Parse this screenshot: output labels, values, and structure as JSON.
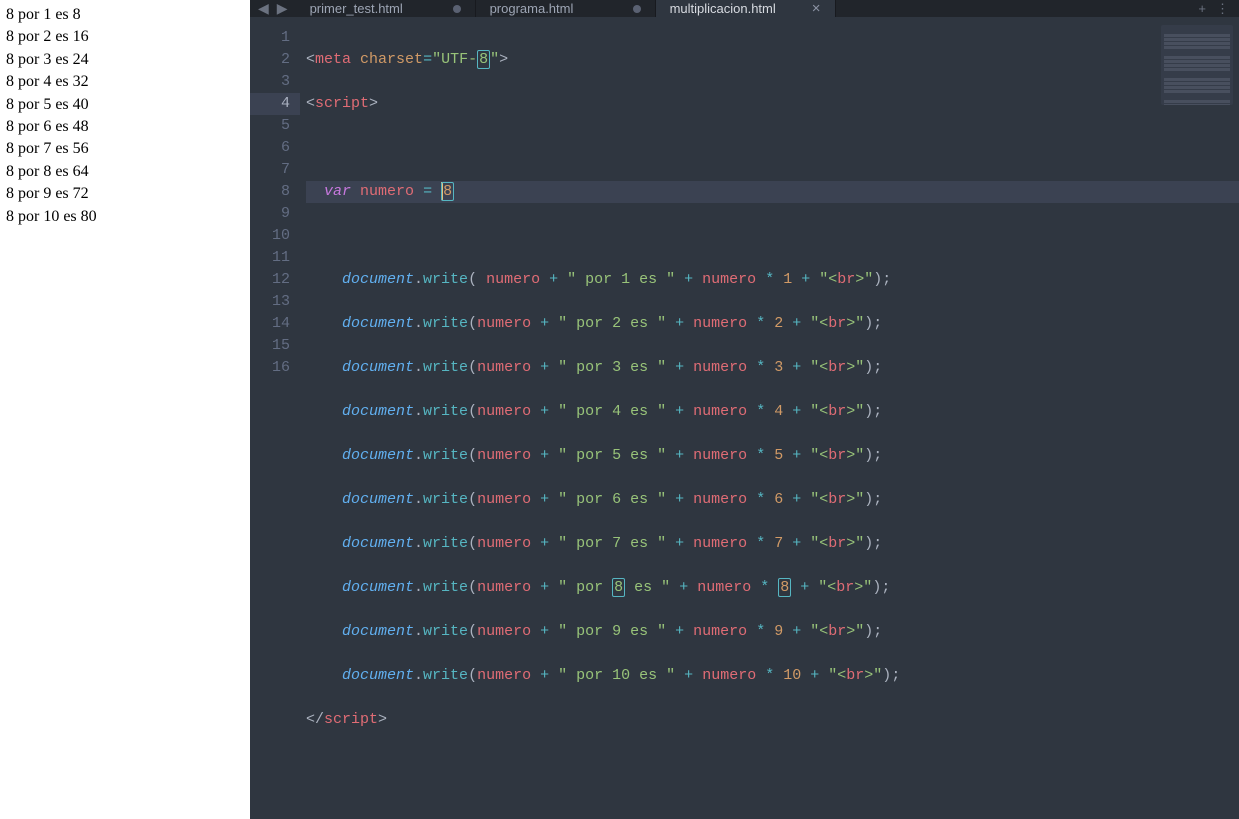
{
  "browser_output": [
    "8 por 1 es 8",
    "8 por 2 es 16",
    "8 por 3 es 24",
    "8 por 4 es 32",
    "8 por 5 es 40",
    "8 por 6 es 48",
    "8 por 7 es 56",
    "8 por 8 es 64",
    "8 por 9 es 72",
    "8 por 10 es 80"
  ],
  "tabs": [
    {
      "label": "primer_test.html",
      "active": false,
      "dirty": true
    },
    {
      "label": "programa.html",
      "active": false,
      "dirty": true
    },
    {
      "label": "multiplicacion.html",
      "active": true,
      "dirty": false
    }
  ],
  "nav": {
    "back": "◀",
    "forward": "▶",
    "plus": "+",
    "more": "⋮"
  },
  "line_numbers": [
    "1",
    "2",
    "3",
    "4",
    "5",
    "6",
    "7",
    "8",
    "9",
    "10",
    "11",
    "12",
    "13",
    "14",
    "15",
    "16"
  ],
  "active_line": 4,
  "code": {
    "l1": {
      "open": "<",
      "tag": "meta",
      "attr": "charset",
      "eq": "=",
      "q1": "\"",
      "str_a": "UTF-",
      "str_hl": "8",
      "q2": "\"",
      "close": ">"
    },
    "l2": {
      "open": "<",
      "tag": "script",
      "close": ">"
    },
    "l4": {
      "key": "var",
      "name": "numero",
      "eq": " = ",
      "val": "8"
    },
    "dw": {
      "obj": "document",
      "dot": ".",
      "meth": "write",
      "lp": "(",
      "lp_sp": "( ",
      "ident": "numero",
      "plus": " + ",
      "q": "\"",
      "por1": " por 1 es ",
      "por2": " por 2 es ",
      "por3": " por 3 es ",
      "por4": " por 4 es ",
      "por5": " por 5 es ",
      "por6": " por 6 es ",
      "por7": " por 7 es ",
      "por8a": " por ",
      "por8b": "8",
      "por8c": " es ",
      "por9": " por 9 es ",
      "por10": " por 10 es ",
      "star": " * ",
      "n1": "1",
      "n2": "2",
      "n3": "3",
      "n4": "4",
      "n5": "5",
      "n6": "6",
      "n7": "7",
      "n8": "8",
      "n9": "9",
      "n10": "10",
      "br_open": "\"<",
      "br_tag": "br",
      "br_close": ">\"",
      "rp": ")",
      "semi": ";"
    },
    "l16": {
      "open": "</",
      "tag": "script",
      "close": ">"
    }
  }
}
